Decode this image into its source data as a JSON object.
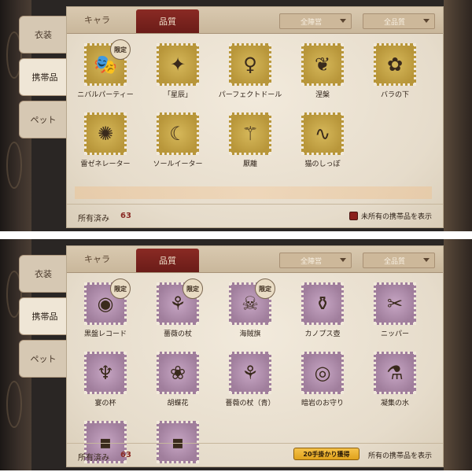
{
  "top": {
    "side_tabs": [
      {
        "label": "衣装"
      },
      {
        "label": "携帯品"
      },
      {
        "label": "ペット"
      }
    ],
    "header": {
      "tab_chara": "キャラ",
      "tab_quality": "品質",
      "camp_dropdown": "全陣営",
      "quality_dropdown": "全品質"
    },
    "items": [
      {
        "label": "ニバルパーティー",
        "icon": "mask-icon",
        "limited": true
      },
      {
        "label": "「星辰」",
        "icon": "star-crystal-icon",
        "limited": false
      },
      {
        "label": "パーフェクトドール",
        "icon": "doll-icon",
        "limited": false
      },
      {
        "label": "涅槃",
        "icon": "phoenix-icon",
        "limited": false
      },
      {
        "label": "バラの下",
        "icon": "rose-icon",
        "limited": false
      },
      {
        "label": "雷ゼネレーター",
        "icon": "generator-icon",
        "limited": false
      },
      {
        "label": "ソールイーター",
        "icon": "scythe-icon",
        "limited": false
      },
      {
        "label": "厭離",
        "icon": "staff-icon",
        "limited": false
      },
      {
        "label": "猫のしっぽ",
        "icon": "cat-tail-icon",
        "limited": false
      }
    ],
    "footer": {
      "owned_label": "所有済み",
      "owned_count": "63",
      "show_unowned": "未所有の携帯品を表示"
    }
  },
  "bottom": {
    "side_tabs": [
      {
        "label": "衣装"
      },
      {
        "label": "携帯品"
      },
      {
        "label": "ペット"
      }
    ],
    "header": {
      "tab_chara": "キャラ",
      "tab_quality": "品質",
      "camp_dropdown": "全陣営",
      "quality_dropdown": "全品質"
    },
    "items": [
      {
        "label": "黒盤レコード",
        "icon": "record-icon",
        "limited": true
      },
      {
        "label": "薔薇の杖",
        "icon": "rose-cane-icon",
        "limited": true
      },
      {
        "label": "海賊旗",
        "icon": "pirate-flag-icon",
        "limited": true
      },
      {
        "label": "カノプス壺",
        "icon": "canopic-jar-icon",
        "limited": false
      },
      {
        "label": "ニッパー",
        "icon": "nipper-icon",
        "limited": false
      },
      {
        "label": "宴の杯",
        "icon": "goblet-icon",
        "limited": false
      },
      {
        "label": "胡蝶花",
        "icon": "butterfly-flower-icon",
        "limited": false
      },
      {
        "label": "薔薇の杖（青）",
        "icon": "blue-rose-cane-icon",
        "limited": false
      },
      {
        "label": "暗岩のお守り",
        "icon": "amulet-icon",
        "limited": false
      },
      {
        "label": "凝集の水",
        "icon": "water-flask-icon",
        "limited": false
      },
      {
        "label": "",
        "icon": "partial-item-icon",
        "limited": false
      },
      {
        "label": "",
        "icon": "partial-item-icon",
        "limited": false
      }
    ],
    "footer": {
      "owned_label": "所有済み",
      "owned_count": "63",
      "show_unowned": "所有の携帯品を表示",
      "hint_badge": "20手掛かり獲得"
    }
  },
  "limited_badge_text": "限定"
}
